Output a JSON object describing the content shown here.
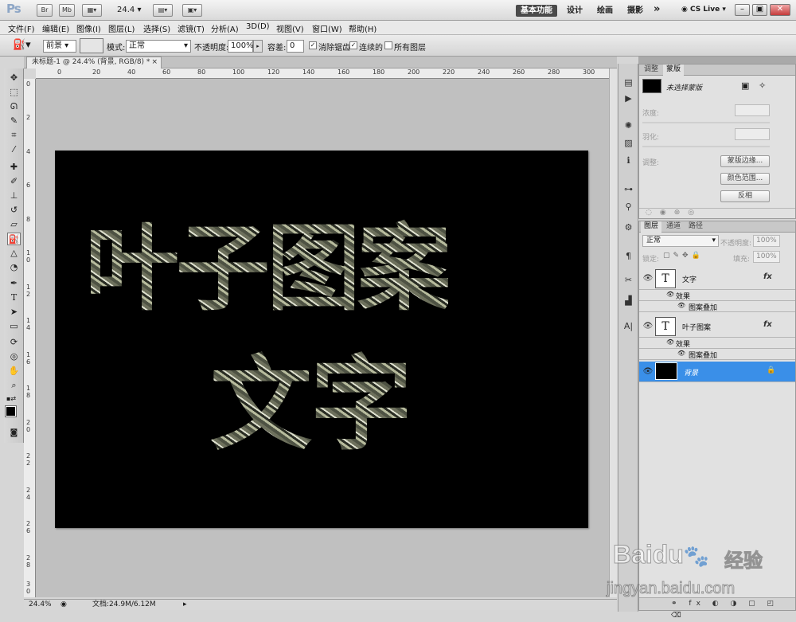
{
  "app": {
    "logo": "Ps",
    "bar_buttons": [
      "Br",
      "Mb"
    ],
    "zoom": "24.4",
    "workspaces": [
      "基本功能",
      "设计",
      "绘画",
      "摄影"
    ],
    "more": "»",
    "cslive": "CS Live",
    "win_controls": [
      "–",
      "▣",
      "✕"
    ]
  },
  "menu": [
    "文件(F)",
    "编辑(E)",
    "图像(I)",
    "图层(L)",
    "选择(S)",
    "滤镜(T)",
    "分析(A)",
    "3D(D)",
    "视图(V)",
    "窗口(W)",
    "帮助(H)"
  ],
  "options": {
    "fill_source": "前景",
    "mode_label": "模式:",
    "mode_value": "正常",
    "opacity_label": "不透明度:",
    "opacity_value": "100%",
    "tolerance_label": "容差:",
    "tolerance_value": "0",
    "antialias_label": "消除锯齿",
    "contiguous_label": "连续的",
    "all_layers_label": "所有图层",
    "antialias_checked": true,
    "contiguous_checked": true,
    "all_layers_checked": false
  },
  "document": {
    "tab_title": "未标题-1 @ 24.4% (背景, RGB/8) *",
    "close": "×",
    "line1": "叶子图案",
    "line2": "文字"
  },
  "rulers": {
    "h": [
      "0",
      "20",
      "40",
      "60",
      "80",
      "100",
      "120",
      "140",
      "160",
      "180",
      "200",
      "220",
      "240",
      "260",
      "280",
      "300"
    ],
    "v": [
      "0",
      "2",
      "4",
      "6",
      "8",
      "1 0",
      "1 2",
      "1 4",
      "1 6",
      "1 8",
      "2 0",
      "2 2",
      "2 4",
      "2 6",
      "2 8",
      "3 0"
    ]
  },
  "status": {
    "zoom": "24.4%",
    "doc_info": "文档:24.9M/6.12M"
  },
  "tools": [
    "move-icon",
    "marquee-icon",
    "lasso-icon",
    "quick-select-icon",
    "crop-icon",
    "eyedropper-icon",
    "healing-icon",
    "brush-icon",
    "stamp-icon",
    "history-brush-icon",
    "eraser-icon",
    "paint-bucket-icon",
    "blur-icon",
    "dodge-icon",
    "pen-icon",
    "type-icon",
    "path-select-icon",
    "shape-icon",
    "3d-rotate-icon",
    "3d-orbit-icon",
    "hand-icon",
    "zoom-icon"
  ],
  "mask_panel": {
    "tabs": [
      "调整",
      "蒙版"
    ],
    "title": "未选择蒙版",
    "density_label": "浓度:",
    "feather_label": "羽化:",
    "refine_label": "调整:",
    "buttons": [
      "蒙版边缘...",
      "颜色范围...",
      "反相"
    ]
  },
  "layers_panel": {
    "tabs": [
      "图层",
      "通道",
      "路径"
    ],
    "blend_mode": "正常",
    "opacity_label": "不透明度:",
    "opacity_value": "100%",
    "lock_label": "锁定:",
    "fill_label": "填充:",
    "fill_value": "100%",
    "layers": [
      {
        "name": "文字",
        "thumb": "T",
        "fx": "fx",
        "effects_label": "效果",
        "effect": "图案叠加"
      },
      {
        "name": "叶子图案",
        "thumb": "T",
        "fx": "fx",
        "effects_label": "效果",
        "effect": "图案叠加"
      },
      {
        "name": "背景",
        "thumb": "",
        "selected": true
      }
    ],
    "footer": "⚭ fx ◐ ◑ ▢ ◰ ⌫"
  },
  "watermark": {
    "brand": "Baidu",
    "paw": "du",
    "suffix": "经验",
    "url": "jingyan.baidu.com"
  },
  "colors": {
    "accent_selected": "#3a8fe8",
    "canvas": "#000000",
    "workspace": "#c0c0c0"
  }
}
